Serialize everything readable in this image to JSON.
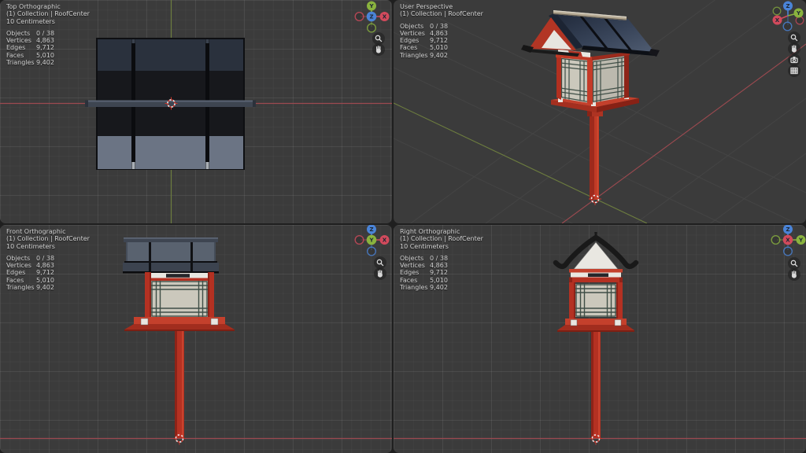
{
  "viewports": {
    "top": {
      "title": "Top Orthographic",
      "collection": "(1) Collection | RoofCenter",
      "scale": "10 Centimeters"
    },
    "user": {
      "title": "User Perspective",
      "collection": "(1) Collection | RoofCenter"
    },
    "front": {
      "title": "Front Orthographic",
      "collection": "(1) Collection | RoofCenter",
      "scale": "10 Centimeters"
    },
    "right": {
      "title": "Right Orthographic",
      "collection": "(1) Collection | RoofCenter",
      "scale": "10 Centimeters"
    }
  },
  "stats": {
    "rows": [
      {
        "label": "Objects",
        "value": "0 / 38"
      },
      {
        "label": "Vertices",
        "value": "4,863"
      },
      {
        "label": "Edges",
        "value": "9,712"
      },
      {
        "label": "Faces",
        "value": "5,010"
      },
      {
        "label": "Triangles",
        "value": "9,402"
      }
    ]
  },
  "gizmo": {
    "x_label": "X",
    "y_label": "Y",
    "z_label": "Z"
  },
  "icons": {
    "zoom": "zoom-icon",
    "hand": "pan-hand-icon",
    "camera": "camera-view-icon",
    "grid": "toggle-ortho-grid-icon"
  },
  "colors": {
    "background": "#3b3b3b",
    "divider": "#1f1f1f",
    "text": "#d2d2d2",
    "axis_x": "#9c4a50",
    "axis_y": "#6d7d3f",
    "gizmo_x": "#d24a5c",
    "gizmo_y": "#8ab33e",
    "gizmo_z": "#4a84d8",
    "gizmo_letter": "#1d2733",
    "lantern_red": "#b43122",
    "lantern_red_bright": "#c4402c",
    "lantern_red_dark": "#8e2318",
    "lantern_red_deep": "#7c1f13",
    "paper": "#cbc8bc",
    "paper_shade": "#bcb9ae",
    "lattice": "#3f4e46",
    "roof_dark": "#17181c",
    "roof_slate": "#2a313d",
    "roof_light": "#6b7484",
    "roof_mid": "#59626f",
    "roof_navy": "#2b3547",
    "roof_panel_light": "#515e73",
    "ridge_beam_tan": "#b5a993",
    "ridge_beam_gray": "#3e4551",
    "gable_white": "#e9e7e1",
    "eave_black": "#191919",
    "plaque": "#26262a",
    "cursor_red": "#c8372d",
    "cursor_white": "#ededed",
    "icon_bg": "#1f1f1f",
    "icon_fg": "#d8d8d8"
  }
}
